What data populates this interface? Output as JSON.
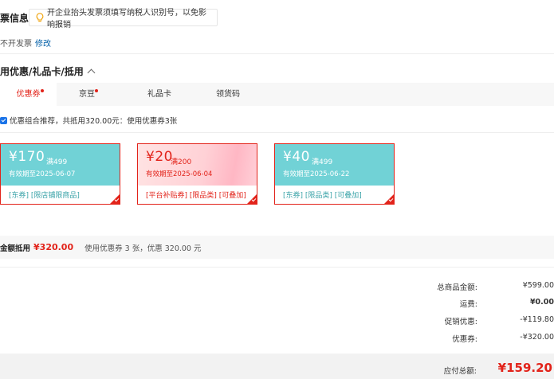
{
  "invoice": {
    "title": "票信息",
    "tip": "开企业抬头发票须填写纳税人识别号，以免影响报销",
    "status": "不开发票",
    "modify": "修改"
  },
  "section": {
    "title": "用优惠/礼品卡/抵用"
  },
  "tabs": [
    {
      "label": "优惠券",
      "active": true,
      "dot": true
    },
    {
      "label": "京豆",
      "active": false,
      "dot": true
    },
    {
      "label": "礼品卡",
      "active": false,
      "dot": false
    },
    {
      "label": "领货码",
      "active": false,
      "dot": false
    }
  ],
  "combo_text": "优惠组合推荐，共抵用320.00元：使用优惠券3张",
  "coupons": [
    {
      "amount": "¥170",
      "condition": "满499",
      "expiry": "有效期至2025-06-07",
      "tags": "[东券] [限店铺限商品]",
      "style": "teal"
    },
    {
      "amount": "¥20",
      "condition": "满200",
      "expiry": "有效期至2025-06-04",
      "tags": "[平台补贴券] [限品类] [可叠加]",
      "style": "pink"
    },
    {
      "amount": "¥40",
      "condition": "满499",
      "expiry": "有效期至2025-06-22",
      "tags": "[东券] [限品类] [可叠加]",
      "style": "teal"
    }
  ],
  "summary": {
    "label": "金额抵用",
    "amount": "¥320.00",
    "detail": "使用优惠券 3 张，优惠 320.00 元"
  },
  "totals": [
    {
      "label": "总商品金额:",
      "value": "¥599.00",
      "bold": false
    },
    {
      "label": "运费:",
      "value": "¥0.00",
      "bold": true
    },
    {
      "label": "促销优惠:",
      "value": "-¥119.80",
      "bold": false
    },
    {
      "label": "优惠券:",
      "value": "-¥320.00",
      "bold": false
    }
  ],
  "payable": {
    "label": "应付总额:",
    "value": "¥159.20"
  },
  "colors": {
    "accent": "#e2231a",
    "teal": "#71d2d6",
    "link": "#005ea7"
  }
}
